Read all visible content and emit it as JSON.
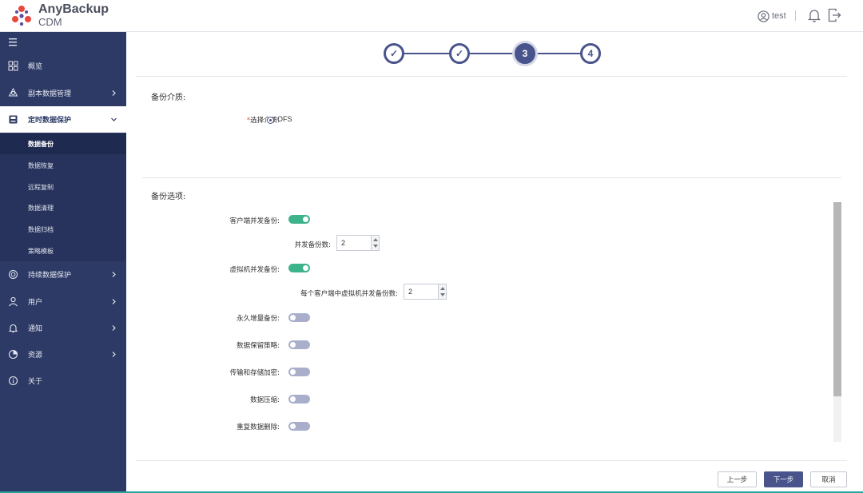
{
  "header": {
    "brand_name": "AnyBackup",
    "brand_sub": "CDM",
    "user_name": "test",
    "icons": [
      "user-circle-icon",
      "bell-icon",
      "logout-icon"
    ]
  },
  "sidebar": {
    "items": [
      {
        "label": "概览",
        "icon": "grid-icon"
      },
      {
        "label": "副本数据管理",
        "icon": "copy-data-icon"
      },
      {
        "label": "定时数据保护",
        "icon": "schedule-protect-icon"
      },
      {
        "label": "持续数据保护",
        "icon": "continuous-protect-icon"
      },
      {
        "label": "用户",
        "icon": "user-icon"
      },
      {
        "label": "通知",
        "icon": "bell-icon"
      },
      {
        "label": "资源",
        "icon": "pie-chart-icon"
      },
      {
        "label": "关于",
        "icon": "info-icon"
      }
    ],
    "submenu": [
      {
        "label": "数据备份"
      },
      {
        "label": "数据恢复"
      },
      {
        "label": "远程复制"
      },
      {
        "label": "数据清理"
      },
      {
        "label": "数据归档"
      },
      {
        "label": "策略模板"
      }
    ]
  },
  "stepper": {
    "steps": [
      "✓",
      "✓",
      "3",
      "4"
    ],
    "current_step": 3
  },
  "media": {
    "section_title": "备份介质:",
    "field_label": "选择介质:",
    "option": "OFS"
  },
  "options": {
    "section_title": "备份选项:",
    "client_concurrent_label": "客户端并发备份:",
    "client_concurrent_on": true,
    "concurrent_count_label": "并发备份数:",
    "concurrent_count_value": "2",
    "vm_concurrent_label": "虚拟机并发备份:",
    "vm_concurrent_on": true,
    "vm_per_client_label": "每个客户端中虚拟机并发备份数:",
    "vm_per_client_value": "2",
    "forever_incremental_label": "永久增量备份:",
    "forever_incremental_on": false,
    "retention_label": "数据保留策略:",
    "retention_on": false,
    "encryption_label": "传输和存储加密:",
    "encryption_on": false,
    "compression_label": "数据压缩:",
    "compression_on": false,
    "dedup_label": "重复数据删除:",
    "dedup_on": false
  },
  "footer": {
    "prev_label": "上一步",
    "next_label": "下一步",
    "cancel_label": "取消"
  },
  "colors": {
    "sidebar": "#2d3a66",
    "accent": "#48548b",
    "toggle_on": "#3db38b",
    "toggle_off": "#a9aecb"
  }
}
